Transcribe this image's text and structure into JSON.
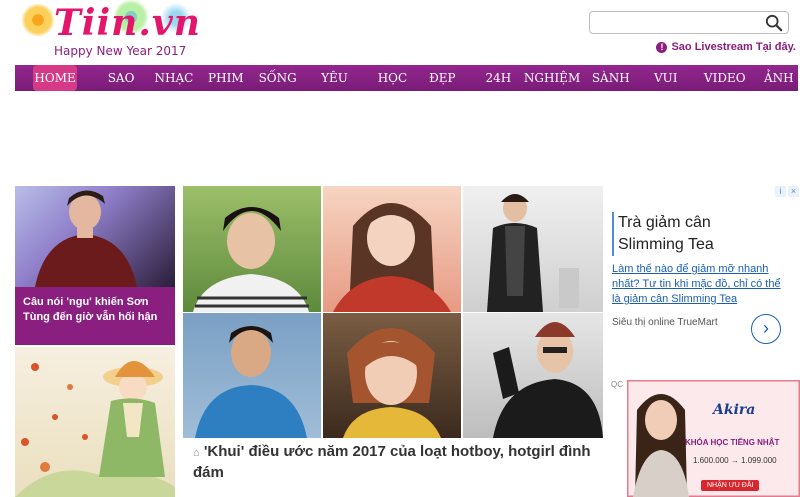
{
  "header": {
    "logo_text": "Tiin.vn",
    "logo_subtitle": "Happy New Year 2017",
    "search_placeholder": "",
    "live_link": "Sao Livestream Tại đây."
  },
  "nav": {
    "items": [
      "HOME",
      "SAO",
      "NHẠC",
      "PHIM",
      "SỐNG",
      "YÊU",
      "HỌC",
      "ĐẸP",
      "24H",
      "NGHIỆM",
      "SÀNH",
      "VUI",
      "VIDEO",
      "ẢNH"
    ],
    "active_index": 0
  },
  "featured": {
    "side_caption": "Câu nói 'ngu' khiến Sơn Tùng đến giờ vẫn hối hận",
    "main_caption_icon": "⌂",
    "main_caption": "'Khui' điều ước năm 2017 của loạt hotboy, hotgirl đình đám"
  },
  "ads": {
    "ad1": {
      "title_line1": "Trà giảm cân",
      "title_line2": "Slimming Tea",
      "description": "Làm thế nào để giảm mỡ nhanh nhất? Tư tin khi mặc đồ, chỉ có thể là giảm cân Slimming Tea",
      "source": "Siêu thị online TrueMart"
    },
    "ad2": {
      "label": "QC",
      "brand": "Akira",
      "headline": "KHÓA HỌC TIẾNG NHẬT",
      "price": "1.600.000 → 1.099.000",
      "button": "NHẬN ƯU ĐÃI"
    }
  },
  "colors": {
    "brand": "#8a1f7d",
    "nav_active": "#d63a87",
    "logo": "#e3166c"
  }
}
